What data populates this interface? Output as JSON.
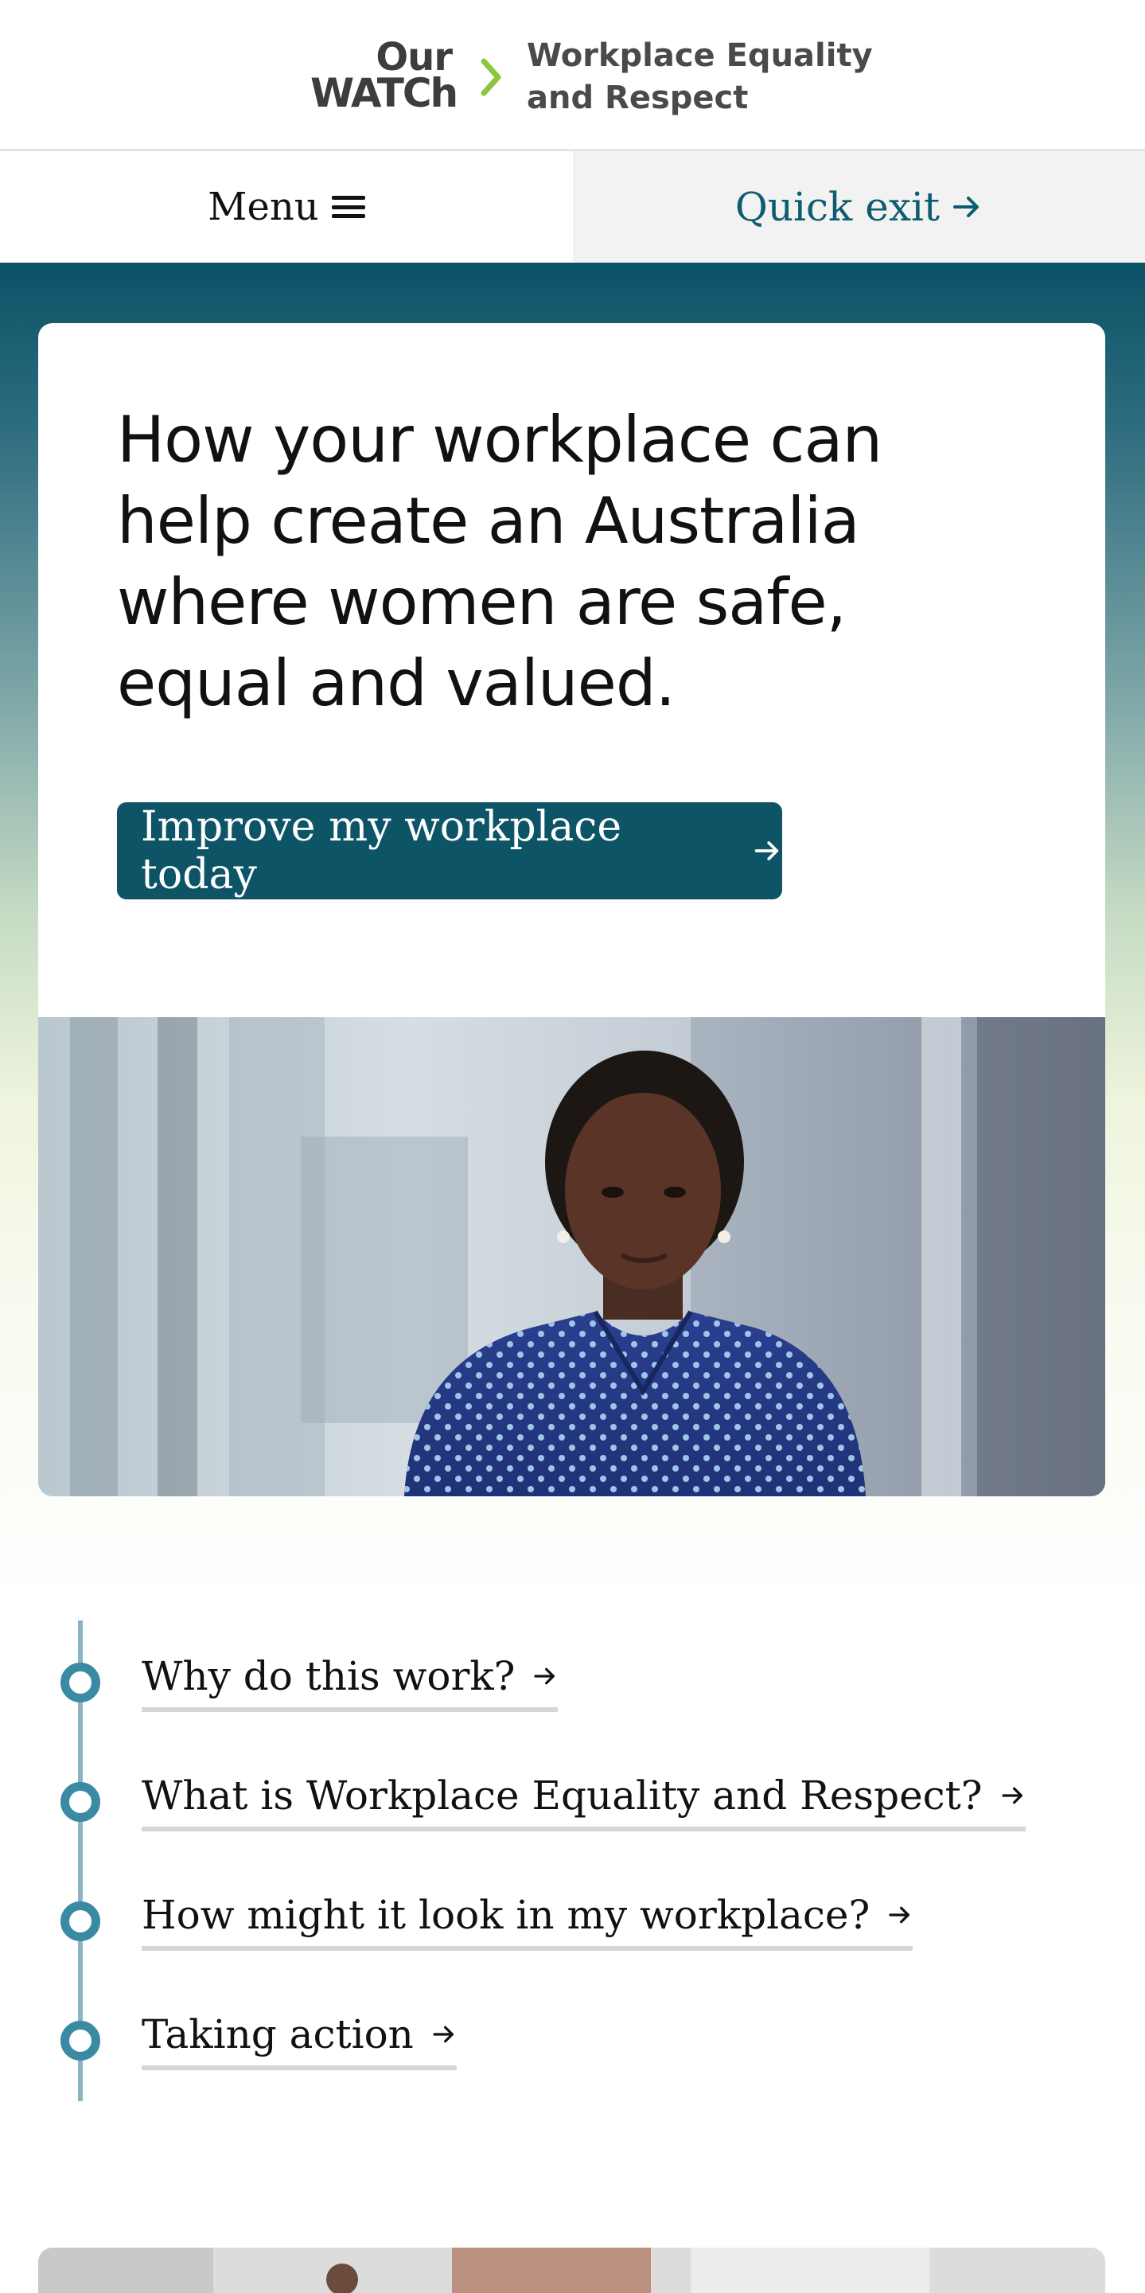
{
  "header": {
    "logo_line1": "Our",
    "logo_line2": "WATCh",
    "site_title": "Workplace Equality\nand Respect",
    "accent": "#8cc63f"
  },
  "nav": {
    "menu_label": "Menu",
    "menu_icon": "hamburger-icon",
    "exit_label": "Quick exit",
    "exit_icon": "arrow-right-icon"
  },
  "hero": {
    "heading": "How your workplace can help create an Australia where women are safe, equal and valued.",
    "cta_label": "Improve my workplace today",
    "cta_color": "#0d5466",
    "photo": "woman-in-blue-polka-dot-shirt-photo"
  },
  "steps": {
    "items": [
      {
        "label": "Why do this work?"
      },
      {
        "label": "What is Workplace Equality and Respect?"
      },
      {
        "label": "How might it look in my workplace?"
      },
      {
        "label": "Taking action"
      }
    ],
    "line_color": "#8ab4c2",
    "dot_color": "#3a8aa3"
  },
  "colors": {
    "primary": "#0b5266",
    "text": "#111111",
    "link_underline": "#d6d6d6"
  }
}
